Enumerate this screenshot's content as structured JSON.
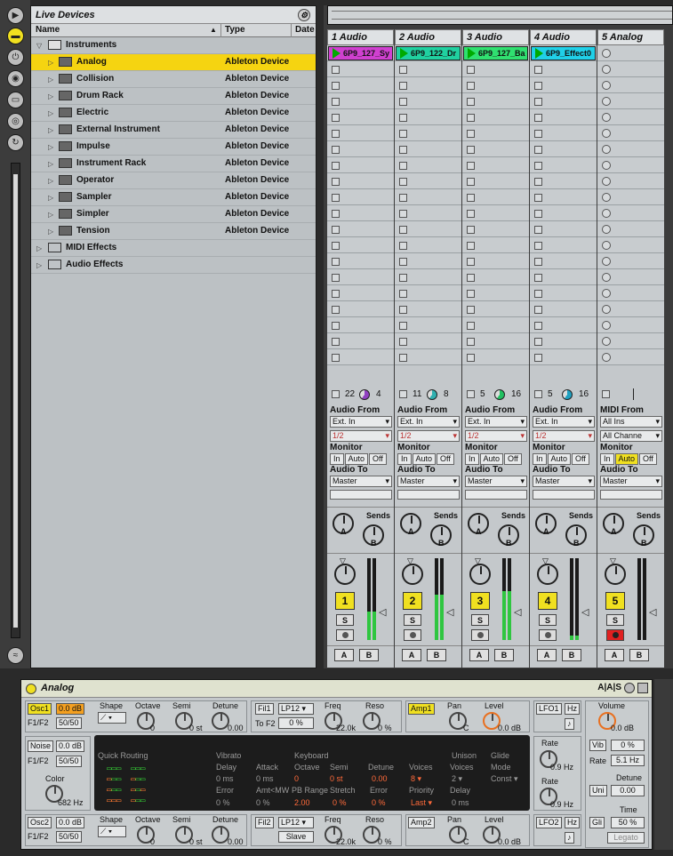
{
  "strip": {
    "buttons": [
      "play-view-icon",
      "browser-toggle-icon",
      "plug-icon",
      "cd-icon",
      "folder-icon",
      "disk-icon",
      "refresh-icon"
    ]
  },
  "browser": {
    "title": "Live Devices",
    "col_name": "Name",
    "col_type": "Type",
    "col_date": "Date",
    "root": "Instruments",
    "items": [
      {
        "name": "Analog",
        "type": "Ableton Device",
        "selected": true
      },
      {
        "name": "Collision",
        "type": "Ableton Device"
      },
      {
        "name": "Drum Rack",
        "type": "Ableton Device"
      },
      {
        "name": "Electric",
        "type": "Ableton Device"
      },
      {
        "name": "External Instrument",
        "type": "Ableton Device"
      },
      {
        "name": "Impulse",
        "type": "Ableton Device"
      },
      {
        "name": "Instrument Rack",
        "type": "Ableton Device"
      },
      {
        "name": "Operator",
        "type": "Ableton Device"
      },
      {
        "name": "Sampler",
        "type": "Ableton Device"
      },
      {
        "name": "Simpler",
        "type": "Ableton Device"
      },
      {
        "name": "Tension",
        "type": "Ableton Device"
      }
    ],
    "folders": [
      "MIDI Effects",
      "Audio Effects"
    ]
  },
  "session": {
    "tracks": [
      {
        "name": "1 Audio",
        "clip": "6P9_127_Sy",
        "clip_color": "#d040d0",
        "n1": "22",
        "n2": "4",
        "pie_color": "#9040c0",
        "audio_from_label": "Audio From",
        "from": "Ext. In",
        "chan": "1/2",
        "monitor_label": "Monitor",
        "mon": [
          "In",
          "Auto",
          "Off"
        ],
        "audio_to_label": "Audio To",
        "to": "Master",
        "sends": "Sends",
        "num": "1",
        "meter": 0.35
      },
      {
        "name": "2 Audio",
        "clip": "6P9_122_Dr",
        "clip_color": "#20d0a0",
        "n1": "11",
        "n2": "8",
        "pie_color": "#30b0b0",
        "audio_from_label": "Audio From",
        "from": "Ext. In",
        "chan": "1/2",
        "monitor_label": "Monitor",
        "mon": [
          "In",
          "Auto",
          "Off"
        ],
        "audio_to_label": "Audio To",
        "to": "Master",
        "sends": "Sends",
        "num": "2",
        "meter": 0.55
      },
      {
        "name": "3 Audio",
        "clip": "6P9_127_Ba",
        "clip_color": "#30e070",
        "n1": "5",
        "n2": "16",
        "pie_color": "#20c060",
        "audio_from_label": "Audio From",
        "from": "Ext. In",
        "chan": "1/2",
        "monitor_label": "Monitor",
        "mon": [
          "In",
          "Auto",
          "Off"
        ],
        "audio_to_label": "Audio To",
        "to": "Master",
        "sends": "Sends",
        "num": "3",
        "meter": 0.6
      },
      {
        "name": "4 Audio",
        "clip": "6P9_Effect0",
        "clip_color": "#20d0e8",
        "n1": "5",
        "n2": "16",
        "pie_color": "#20a0c0",
        "audio_from_label": "Audio From",
        "from": "Ext. In",
        "chan": "1/2",
        "monitor_label": "Monitor",
        "mon": [
          "In",
          "Auto",
          "Off"
        ],
        "audio_to_label": "Audio To",
        "to": "Master",
        "sends": "Sends",
        "num": "4",
        "meter": 0.05
      }
    ],
    "midi_track": {
      "name": "5 Analog",
      "from_label": "MIDI From",
      "from": "All Ins",
      "chan": "All Channe",
      "monitor_label": "Monitor",
      "mon": [
        "In",
        "Auto",
        "Off"
      ],
      "audio_to_label": "Audio To",
      "to": "Master",
      "sends": "Sends",
      "num": "5"
    },
    "knob_a": "A",
    "knob_b": "B",
    "solo": "S",
    "ab_a": "A",
    "ab_b": "B"
  },
  "device": {
    "title": "Analog",
    "header_icons": "A|A|S",
    "osc1": {
      "label": "Osc1",
      "level": "0.0 dB",
      "f1f2_label": "F1/F2",
      "f1f2": "50/50",
      "shape_label": "Shape",
      "octave_label": "Octave",
      "octave": "0",
      "semi_label": "Semi",
      "semi": "0 st",
      "detune_label": "Detune",
      "detune": "0.00"
    },
    "fil1": {
      "label": "Fil1",
      "type": "LP12",
      "to_f2_label": "To F2",
      "to_f2": "0 %",
      "freq_label": "Freq",
      "freq": "22.0k",
      "reso_label": "Reso",
      "reso": "0 %"
    },
    "amp1": {
      "label": "Amp1",
      "pan_label": "Pan",
      "pan": "C",
      "level_label": "Level",
      "level": "0.0 dB"
    },
    "lfo1": {
      "label": "LFO1",
      "hz": "Hz",
      "note": "♪",
      "rate_label": "Rate",
      "rate": "0.9 Hz"
    },
    "noise": {
      "label": "Noise",
      "level": "0.0 dB",
      "f1f2_label": "F1/F2",
      "f1f2": "50/50",
      "color_label": "Color",
      "color": "682 Hz"
    },
    "quick": {
      "routing": "Quick Routing",
      "vibrato": "Vibrato",
      "delay_label": "Delay",
      "delay": "0 ms",
      "attack_label": "Attack",
      "attack": "0 ms",
      "error_label": "Error",
      "error": "0 %",
      "amtmw_label": "Amt<MW",
      "amtmw": "0 %",
      "keyboard": "Keyboard",
      "octave_label": "Octave",
      "octave": "0",
      "semi_label": "Semi",
      "semi": "0 st",
      "detune_label": "Detune",
      "detune": "0.00",
      "pbrange_label": "PB Range",
      "pbrange": "2.00",
      "stretch_label": "Stretch",
      "stretch": "0 %",
      "kerror_label": "Error",
      "kerror": "0 %",
      "voices_label": "Voices",
      "voices": "8",
      "priority_label": "Priority",
      "priority": "Last",
      "unison": "Unison",
      "uvoices_label": "Voices",
      "uvoices": "2",
      "udelay_label": "Delay",
      "udelay": "0 ms",
      "glide": "Glide",
      "mode_label": "Mode",
      "mode": "Const"
    },
    "global": {
      "volume_label": "Volume",
      "volume": "0.0 dB",
      "vib": "Vib",
      "vib_val": "0 %",
      "rate_label": "Rate",
      "rate": "5.1 Hz",
      "uni": "Uni",
      "detune_label": "Detune",
      "detune": "0.00",
      "gli": "Gli",
      "time_label": "Time",
      "time": "50 %",
      "legato": "Legato"
    },
    "lfo_rate2_label": "Rate",
    "lfo_rate2": "0.9 Hz",
    "osc2": {
      "label": "Osc2",
      "level": "0.0 dB",
      "f1f2_label": "F1/F2",
      "f1f2": "50/50",
      "shape_label": "Shape",
      "octave_label": "Octave",
      "octave": "0",
      "semi_label": "Semi",
      "semi": "0 st",
      "detune_label": "Detune",
      "detune": "0.00"
    },
    "fil2": {
      "label": "Fil2",
      "type": "LP12",
      "slave": "Slave",
      "freq_label": "Freq",
      "freq": "22.0k",
      "reso_label": "Reso",
      "reso": "0 %"
    },
    "amp2": {
      "label": "Amp2",
      "pan_label": "Pan",
      "pan": "C",
      "level_label": "Level",
      "level": "0.0 dB"
    },
    "lfo2": {
      "label": "LFO2",
      "hz": "Hz",
      "note": "♪"
    }
  }
}
